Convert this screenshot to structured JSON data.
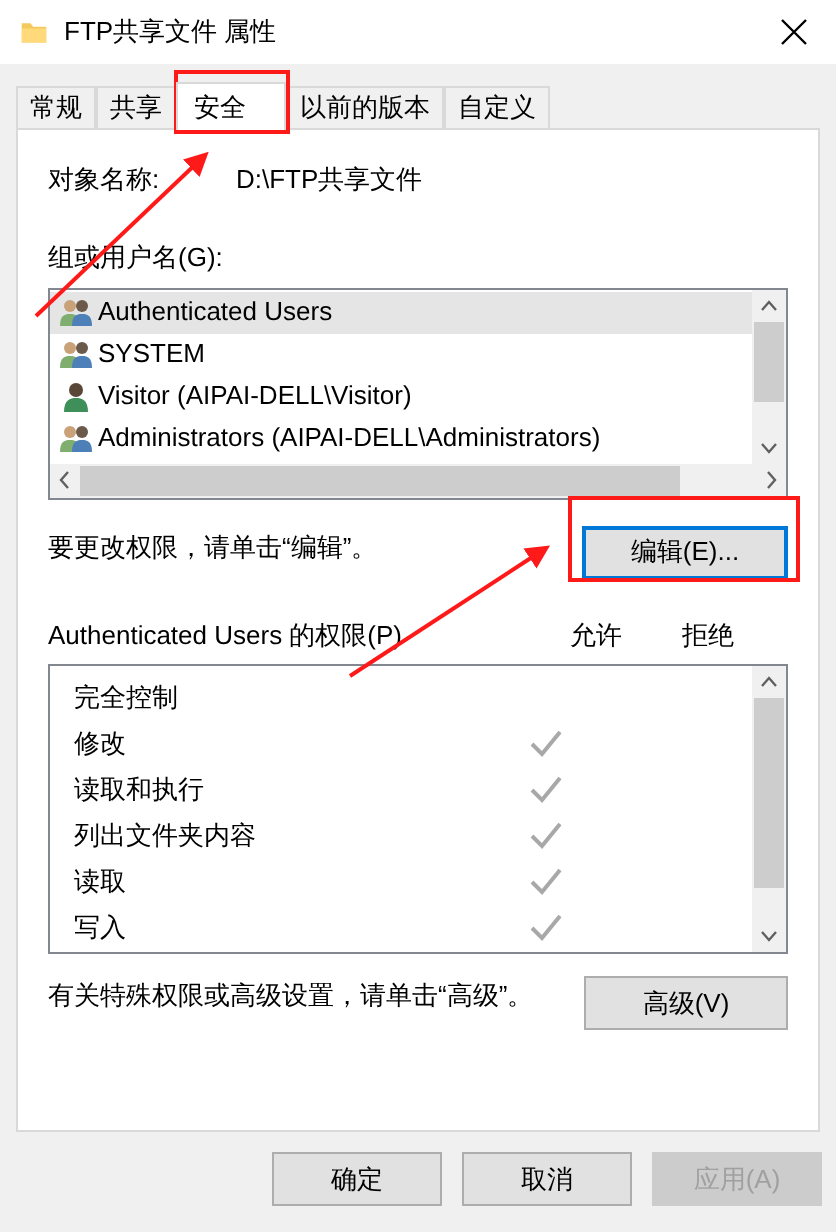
{
  "window": {
    "title": "FTP共享文件 属性"
  },
  "tabs": [
    {
      "label": "常规",
      "selected": false
    },
    {
      "label": "共享",
      "selected": false
    },
    {
      "label": "安全",
      "selected": true
    },
    {
      "label": "以前的版本",
      "selected": false
    },
    {
      "label": "自定义",
      "selected": false
    }
  ],
  "object_name": {
    "label": "对象名称:",
    "value": "D:\\FTP共享文件"
  },
  "users": {
    "label": "组或用户名(G):",
    "items": [
      {
        "name": "Authenticated Users",
        "kind": "group",
        "selected": true
      },
      {
        "name": "SYSTEM",
        "kind": "group",
        "selected": false
      },
      {
        "name": "Visitor (AIPAI-DELL\\Visitor)",
        "kind": "user",
        "selected": false
      },
      {
        "name": "Administrators (AIPAI-DELL\\Administrators)",
        "kind": "group",
        "selected": false
      }
    ]
  },
  "edit_hint": "要更改权限，请单击“编辑”。",
  "edit_button": {
    "label": "编辑(E)...",
    "focused": true
  },
  "permissions": {
    "label": "Authenticated Users 的权限(P)",
    "allow_header": "允许",
    "deny_header": "拒绝",
    "rows": [
      {
        "name": "完全控制",
        "allow": false,
        "deny": false
      },
      {
        "name": "修改",
        "allow": true,
        "deny": false
      },
      {
        "name": "读取和执行",
        "allow": true,
        "deny": false
      },
      {
        "name": "列出文件夹内容",
        "allow": true,
        "deny": false
      },
      {
        "name": "读取",
        "allow": true,
        "deny": false
      },
      {
        "name": "写入",
        "allow": true,
        "deny": false
      }
    ]
  },
  "advanced_hint": "有关特殊权限或高级设置，请单击“高级”。",
  "advanced_button": {
    "label": "高级(V)"
  },
  "buttons": [
    {
      "label": "确定",
      "disabled": false
    },
    {
      "label": "取消",
      "disabled": false
    },
    {
      "label": "应用(A)",
      "disabled": true
    }
  ]
}
